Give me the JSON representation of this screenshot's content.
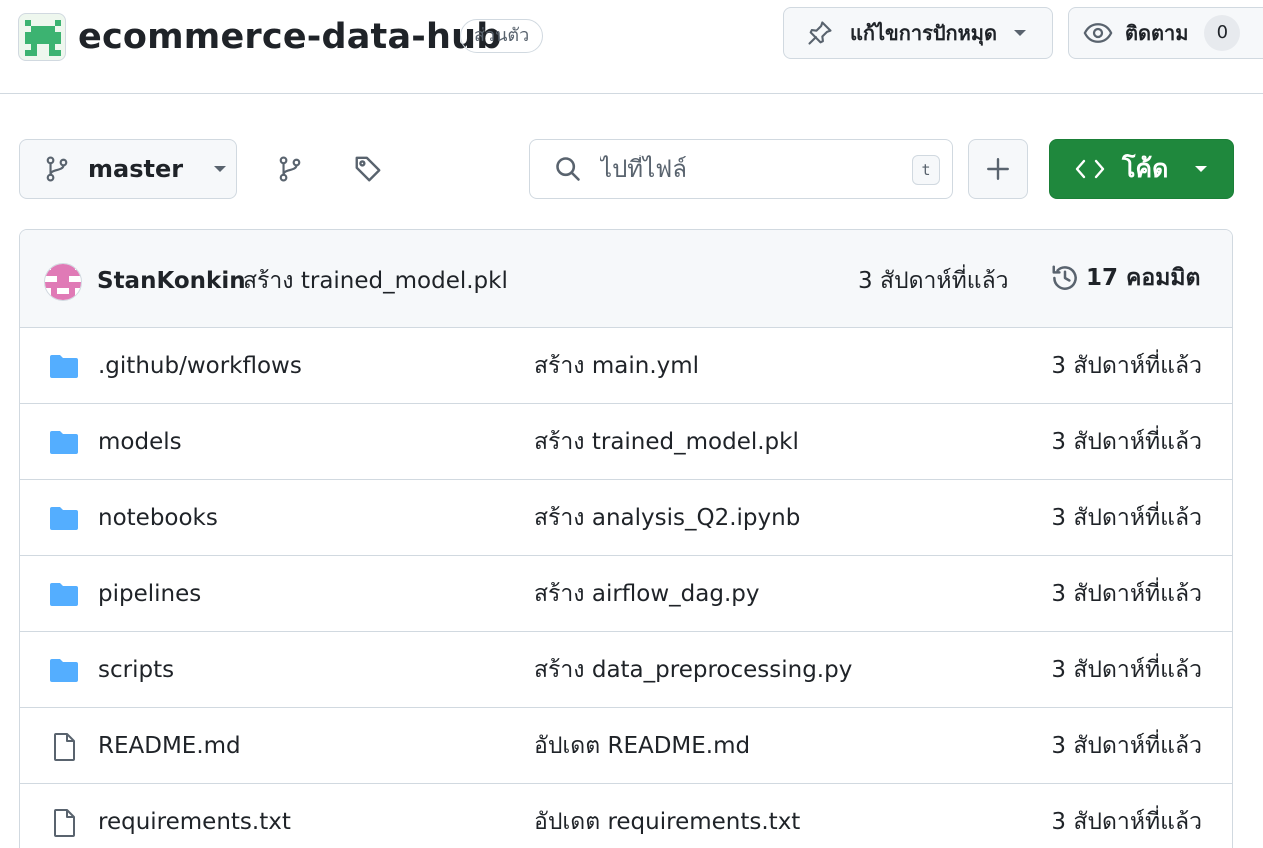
{
  "repo": {
    "name": "ecommerce-data-hub",
    "visibility": "ส่วนตัว"
  },
  "header_actions": {
    "pin_label": "แก้ไขการปักหมุด",
    "watch_label": "ติดตาม",
    "watch_count": "0"
  },
  "toolbar": {
    "branch": "master",
    "search_placeholder": "ไปที่ไฟล์",
    "search_shortcut": "t",
    "code_label": "โค้ด"
  },
  "latest_commit": {
    "author": "StanKonkin",
    "message": "สร้าง trained_model.pkl",
    "time": "3 สัปดาห์ที่แล้ว",
    "commit_count": "17 คอมมิต"
  },
  "files": [
    {
      "type": "folder",
      "name": ".github/workflows",
      "commit": "สร้าง main.yml",
      "time": "3 สัปดาห์ที่แล้ว"
    },
    {
      "type": "folder",
      "name": "models",
      "commit": "สร้าง trained_model.pkl",
      "time": "3 สัปดาห์ที่แล้ว"
    },
    {
      "type": "folder",
      "name": "notebooks",
      "commit": "สร้าง analysis_Q2.ipynb",
      "time": "3 สัปดาห์ที่แล้ว"
    },
    {
      "type": "folder",
      "name": "pipelines",
      "commit": "สร้าง airflow_dag.py",
      "time": "3 สัปดาห์ที่แล้ว"
    },
    {
      "type": "folder",
      "name": "scripts",
      "commit": "สร้าง data_preprocessing.py",
      "time": "3 สัปดาห์ที่แล้ว"
    },
    {
      "type": "file",
      "name": "README.md",
      "commit": "อัปเดต README.md",
      "time": "3 สัปดาห์ที่แล้ว"
    },
    {
      "type": "file",
      "name": "requirements.txt",
      "commit": "อัปเดต requirements.txt",
      "time": "3 สัปดาห์ที่แล้ว"
    }
  ],
  "colors": {
    "accent_green": "#1f883d",
    "folder_blue": "#54aeff",
    "border": "#d1d9e0"
  }
}
